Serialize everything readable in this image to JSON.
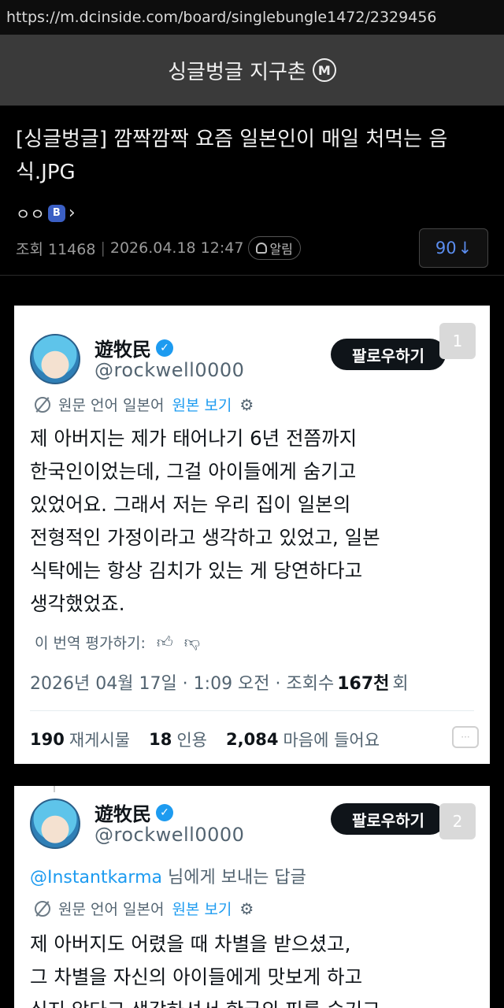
{
  "browser": {
    "url": "https://m.dcinside.com/board/singlebungle1472/2329456"
  },
  "gallery": {
    "title": "싱글벙글 지구촌",
    "badge": "M"
  },
  "post": {
    "title": "[싱글벙글] 깜짝깜짝 요즘 일본인이 매일 처먹는 음식.JPG",
    "author": "ㅇㅇ",
    "author_badge": "B",
    "views_label": "조회 11468",
    "date": "2026.04.18 12:47",
    "alarm_label": "알림",
    "comment_count": "90",
    "comment_arrow": "↓"
  },
  "tweets": [
    {
      "image_index": "1",
      "display_name": "遊牧民",
      "handle": "@rockwell0000",
      "follow_label": "팔로우하기",
      "orig_lang_label": "원문 언어 일본어",
      "view_original_label": "원본 보기",
      "text": "제 아버지는 제가 태어나기 6년 전쯤까지\n한국인이었는데, 그걸 아이들에게 숨기고\n있었어요. 그래서 저는 우리 집이 일본의\n전형적인 가정이라고 생각하고 있었고, 일본\n식탁에는 항상 김치가 있는 게 당연하다고\n생각했었죠.",
      "rate_label": "이 번역 평가하기:",
      "date_text": "2026년 04월 17일 · 1:09 오전 · 조회수",
      "views_number": "167천",
      "views_suffix": "회",
      "retweets_count": "190",
      "retweets_label": "재게시물",
      "quotes_count": "18",
      "quotes_label": "인용",
      "likes_count": "2,084",
      "likes_label": "마음에 들어요"
    },
    {
      "image_index": "2",
      "display_name": "遊牧民",
      "handle": "@rockwell0000",
      "follow_label": "팔로우하기",
      "reply_mention": "@Instantkarma",
      "reply_suffix": "님에게 보내는 답글",
      "orig_lang_label": "원문 언어 일본어",
      "view_original_label": "원본 보기",
      "text": "제 아버지도 어렸을 때 차별을 받으셨고,\n그 차별을 자신의 아이들에게 맛보게 하고\n싶지 않다고 생각하셔서 한국의 피를 숨기고"
    }
  ],
  "colors": {
    "link": "#1d9bf0",
    "comment_count": "#5b8def",
    "badge_b": "#3b5fc4"
  }
}
